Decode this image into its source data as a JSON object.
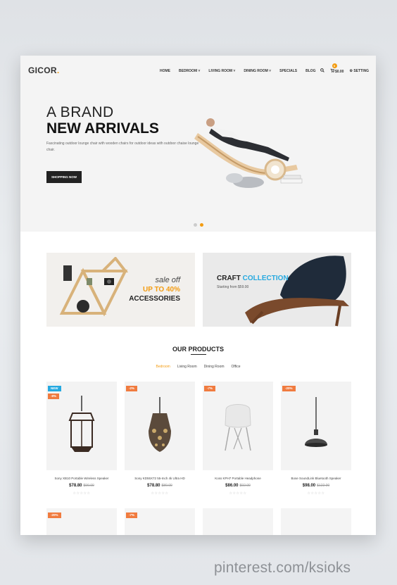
{
  "brand": {
    "logo": "GICOR"
  },
  "nav": [
    "HOME",
    "BEDROOM ˅",
    "LIVING ROOM ˅",
    "DINING ROOM ˅",
    "SPECIALS",
    "BLOG"
  ],
  "tools": {
    "cart_total": "$0.00",
    "cart_count": "0",
    "setting": "SETTING"
  },
  "hero": {
    "title1": "A BRAND",
    "title2": "NEW ARRIVALS",
    "desc": "Fascinating outdoor lounge chair with wooden chairs for outdoor ideas with outdoor chaise lounge chair.",
    "button": "SHOPPING NOW"
  },
  "banners": {
    "left": {
      "line1": "sale off",
      "line2": "UP TO 40%",
      "line3": "ACCESSORIES"
    },
    "right": {
      "title_a": "CRAFT",
      "title_b": "COLLECTION",
      "sub": "Starting from $59.00"
    }
  },
  "products_section": {
    "title": "OUR PRODUCTS",
    "filters": [
      "Bedroom",
      "Living Room",
      "Dining Room",
      "Office"
    ],
    "active_filter": "Bedroom"
  },
  "products": [
    {
      "name": "Sony XB10 Portable Wireless Speaker",
      "price": "$78.80",
      "old_price": "$90.00",
      "tags": [
        "NEW",
        "-8%"
      ],
      "stars": "☆☆☆☆☆"
    },
    {
      "name": "Sony KD55X72 55-Inch 4k Ultra HD",
      "price": "$78.80",
      "old_price": "$80.00",
      "tags": [
        "-2%"
      ],
      "stars": "☆☆☆☆☆"
    },
    {
      "name": "Koss KPH7 Portable Headphone",
      "price": "$86.00",
      "old_price": "$92.00",
      "tags": [
        "-7%"
      ],
      "stars": "☆☆☆☆☆"
    },
    {
      "name": "Bose SoundLink Bluetooth Speaker",
      "price": "$98.00",
      "old_price": "$122.00",
      "tags": [
        "-20%"
      ],
      "stars": "☆☆☆☆☆"
    }
  ],
  "row2_tags": [
    "-20%",
    "-7%",
    "",
    ""
  ],
  "watermark": "pinterest.com/ksioks",
  "colors": {
    "accent": "#f39c12",
    "blue": "#26a9e0",
    "sale": "#f07b3f"
  }
}
